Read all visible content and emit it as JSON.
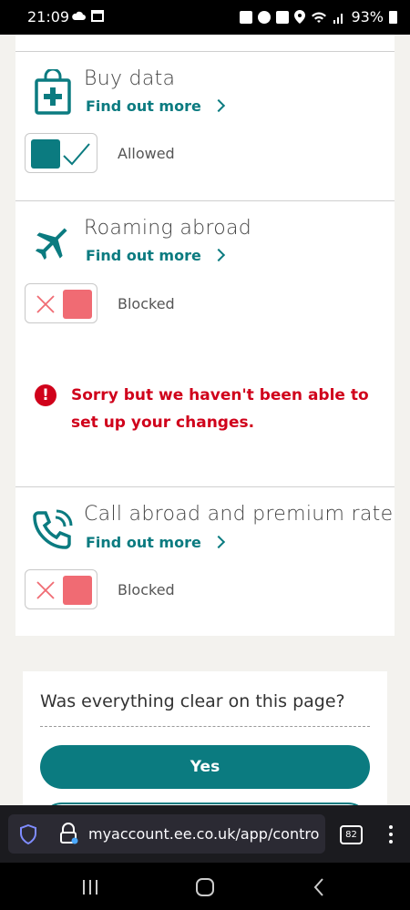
{
  "status_bar": {
    "time": "21:09",
    "battery": "93%",
    "left_icons": [
      "cloud-icon",
      "calendar-icon"
    ],
    "right_icons": [
      "lock-icon",
      "alarm-icon",
      "mute-icon",
      "location-icon",
      "wifi-icon",
      "signal-icon",
      "battery-icon"
    ]
  },
  "sections": [
    {
      "title": "Buy data",
      "link": "Find out more",
      "icon": "shopping-bag-plus-icon",
      "toggle_state": "on",
      "state_label": "Allowed"
    },
    {
      "title": "Roaming abroad",
      "link": "Find out more",
      "icon": "airplane-icon",
      "toggle_state": "off",
      "state_label": "Blocked"
    },
    {
      "title": "Call abroad and premium rate",
      "link": "Find out more",
      "icon": "phone-call-icon",
      "toggle_state": "off",
      "state_label": "Blocked"
    }
  ],
  "error": {
    "icon": "exclamation",
    "message": "Sorry but we haven't been able to set up your changes."
  },
  "feedback": {
    "question": "Was everything clear on this page?",
    "yes_label": "Yes"
  },
  "browser": {
    "url": "myaccount.ee.co.uk/app/contro",
    "tab_count": "82"
  },
  "colors": {
    "brand_teal": "#0b7b80",
    "blocked_red": "#f06b73",
    "error_red": "#d0021b"
  }
}
